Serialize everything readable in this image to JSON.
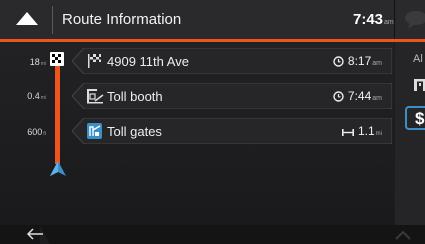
{
  "header": {
    "title": "Route Information",
    "time": "7:43",
    "time_suffix": "am"
  },
  "route": {
    "items": [
      {
        "distance": "18",
        "distance_unit": "mi",
        "icon": "checkered-flag-icon",
        "label": "4909 11th Ave",
        "meta_icon": "clock-icon",
        "meta": "8:17",
        "meta_suffix": "am"
      },
      {
        "distance": "0.4",
        "distance_unit": "mi",
        "icon": "toll-booth-icon",
        "label": "Toll booth",
        "meta_icon": "clock-icon",
        "meta": "7:44",
        "meta_suffix": "am"
      },
      {
        "distance": "600",
        "distance_unit": "ft",
        "icon": "toll-gates-icon",
        "label": "Toll gates",
        "meta_icon": "length-icon",
        "meta": "1.1",
        "meta_suffix": "mi"
      }
    ]
  },
  "right_panel": {
    "text": "Al",
    "box_label": "$"
  },
  "colors": {
    "accent": "#f0541e",
    "nav_arrow": "#3a8fc8"
  }
}
